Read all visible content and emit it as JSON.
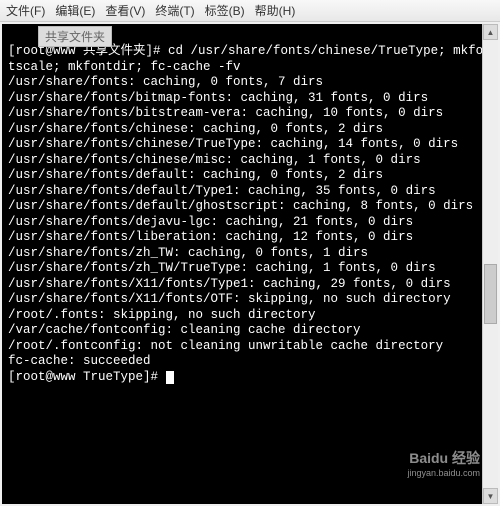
{
  "menubar": {
    "items": [
      "文件(F)",
      "编辑(E)",
      "查看(V)",
      "终端(T)",
      "标签(B)",
      "帮助(H)"
    ]
  },
  "tab": {
    "label": "共享文件夹"
  },
  "terminal": {
    "prompt1": "[root@www 共享文件夹]# ",
    "cmd1": "cd /usr/share/fonts/chinese/TrueType; mkfontscale; mkfontdir; fc-cache -fv",
    "lines": [
      "/usr/share/fonts: caching, 0 fonts, 7 dirs",
      "/usr/share/fonts/bitmap-fonts: caching, 31 fonts, 0 dirs",
      "/usr/share/fonts/bitstream-vera: caching, 10 fonts, 0 dirs",
      "/usr/share/fonts/chinese: caching, 0 fonts, 2 dirs",
      "/usr/share/fonts/chinese/TrueType: caching, 14 fonts, 0 dirs",
      "/usr/share/fonts/chinese/misc: caching, 1 fonts, 0 dirs",
      "/usr/share/fonts/default: caching, 0 fonts, 2 dirs",
      "/usr/share/fonts/default/Type1: caching, 35 fonts, 0 dirs",
      "/usr/share/fonts/default/ghostscript: caching, 8 fonts, 0 dirs",
      "/usr/share/fonts/dejavu-lgc: caching, 21 fonts, 0 dirs",
      "/usr/share/fonts/liberation: caching, 12 fonts, 0 dirs",
      "/usr/share/fonts/zh_TW: caching, 0 fonts, 1 dirs",
      "/usr/share/fonts/zh_TW/TrueType: caching, 1 fonts, 0 dirs",
      "/usr/share/fonts/X11/fonts/Type1: caching, 29 fonts, 0 dirs",
      "/usr/share/fonts/X11/fonts/OTF: skipping, no such directory",
      "/root/.fonts: skipping, no such directory",
      "/var/cache/fontconfig: cleaning cache directory",
      "/root/.fontconfig: not cleaning unwritable cache directory",
      "fc-cache: succeeded"
    ],
    "prompt2": "[root@www TrueType]# "
  },
  "watermark": {
    "brand": "Baidu 经验",
    "url": "jingyan.baidu.com"
  }
}
